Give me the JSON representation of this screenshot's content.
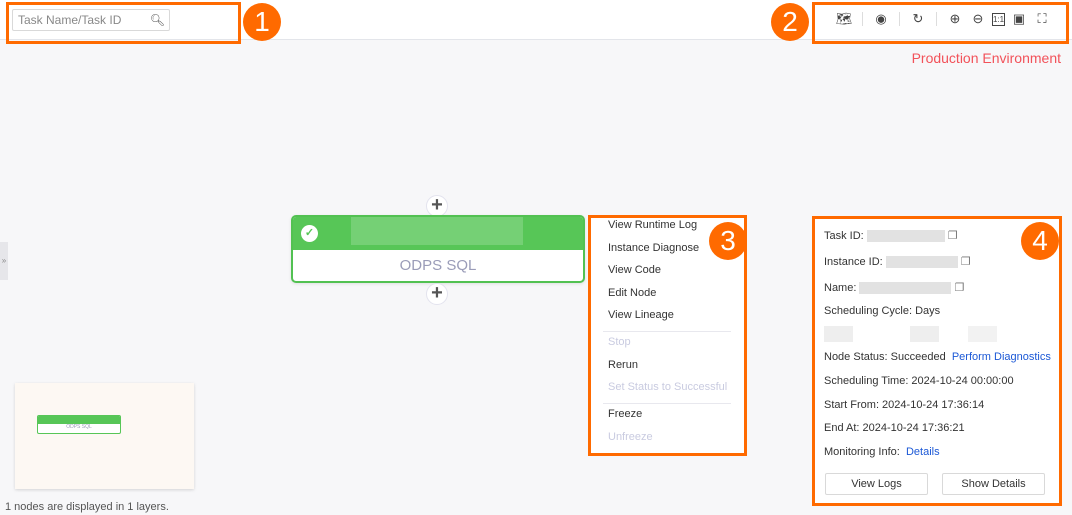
{
  "search": {
    "placeholder": "Task Name/Task ID",
    "icon": "search-icon"
  },
  "toolbar": {
    "icons": [
      "map-icon",
      "eye-icon",
      "refresh-icon",
      "zoom-in-icon",
      "zoom-out-icon",
      "actual-size-icon",
      "fit-screen-icon",
      "fullscreen-icon"
    ],
    "actual_size_label": "1:1"
  },
  "environment": "Production Environment",
  "callouts": [
    "1",
    "2",
    "3",
    "4"
  ],
  "node": {
    "type": "ODPS SQL",
    "status": "success",
    "color": "#57c657"
  },
  "context_menu": {
    "items": [
      {
        "label": "View Runtime Log",
        "disabled": false
      },
      {
        "label": "Instance Diagnose",
        "disabled": false
      },
      {
        "label": "View Code",
        "disabled": false
      },
      {
        "label": "Edit Node",
        "disabled": false
      },
      {
        "label": "View Lineage",
        "disabled": false
      },
      {
        "label": "Stop",
        "disabled": true
      },
      {
        "label": "Rerun",
        "disabled": false
      },
      {
        "label": "Set Status to Successful",
        "disabled": true
      },
      {
        "label": "Freeze",
        "disabled": false
      },
      {
        "label": "Unfreeze",
        "disabled": true
      }
    ]
  },
  "panel": {
    "task_id_label": "Task ID:",
    "instance_id_label": "Instance ID:",
    "name_label": "Name:",
    "scheduling_cycle": "Scheduling Cycle: Days",
    "node_status": "Node Status: Succeeded",
    "perform_diagnostics": "Perform Diagnostics",
    "scheduling_time": "Scheduling Time: 2024-10-24 00:00:00",
    "start_from": "Start From: 2024-10-24 17:36:14",
    "end_at": "End At: 2024-10-24 17:36:21",
    "monitoring_label": "Monitoring Info:",
    "details_link": "Details",
    "view_logs": "View Logs",
    "show_details": "Show Details"
  },
  "minimap": {
    "node_type": "ODPS SQL"
  },
  "footer": "1 nodes are displayed in 1 layers.",
  "accent": "#ff6a00"
}
